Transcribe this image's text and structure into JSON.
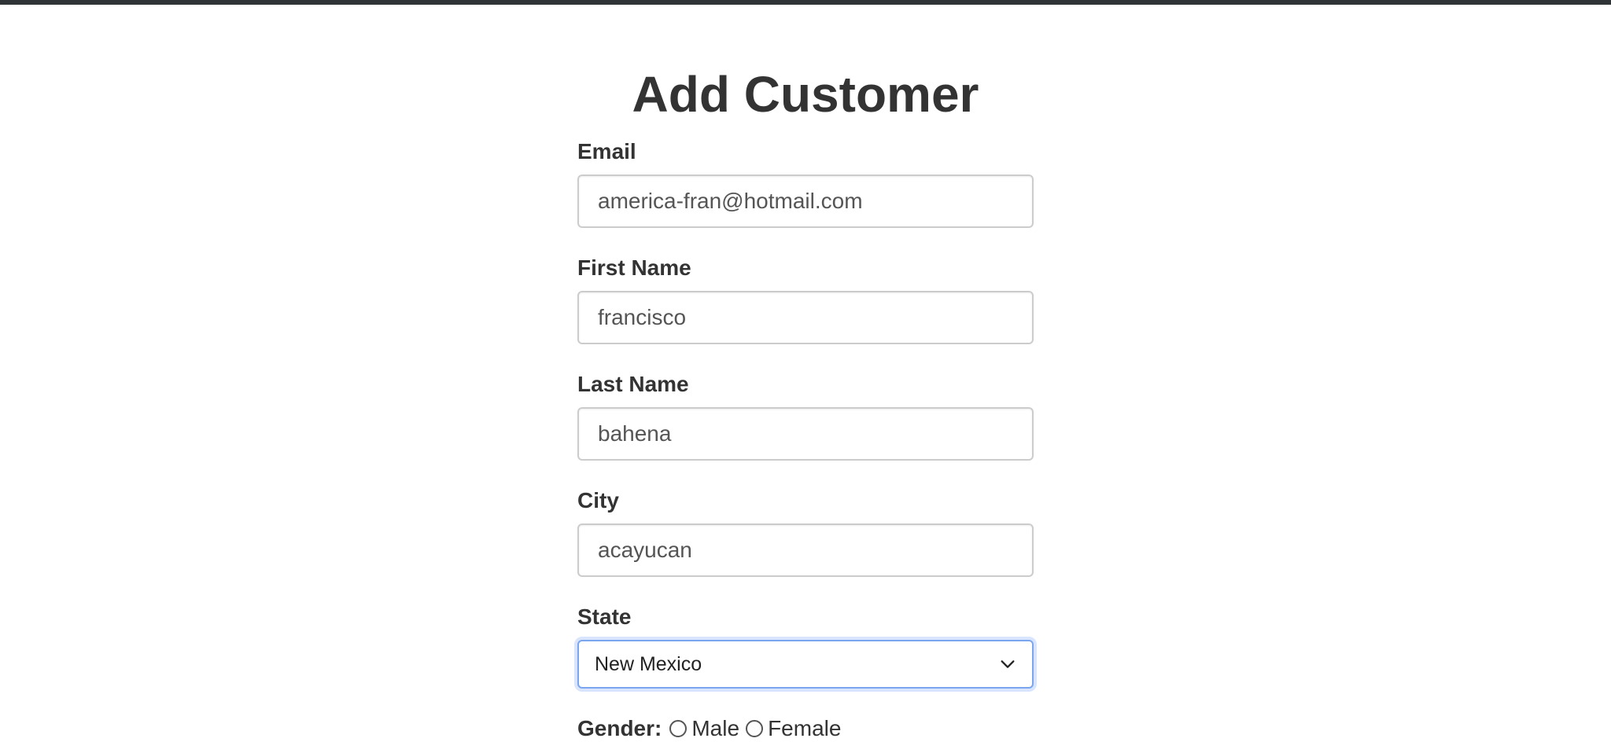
{
  "page": {
    "title": "Add Customer"
  },
  "form": {
    "email": {
      "label": "Email",
      "value": "america-fran@hotmail.com"
    },
    "first_name": {
      "label": "First Name",
      "value": "francisco"
    },
    "last_name": {
      "label": "Last Name",
      "value": "bahena"
    },
    "city": {
      "label": "City",
      "value": "acayucan"
    },
    "state": {
      "label": "State",
      "selected": "New Mexico",
      "icon": "chevron-down-icon"
    },
    "gender": {
      "label": "Gender:",
      "options": [
        "Male",
        "Female"
      ]
    }
  },
  "colors": {
    "top_bar": "#2f3437",
    "focus_border": "#7aa6f0",
    "text": "#333333"
  }
}
